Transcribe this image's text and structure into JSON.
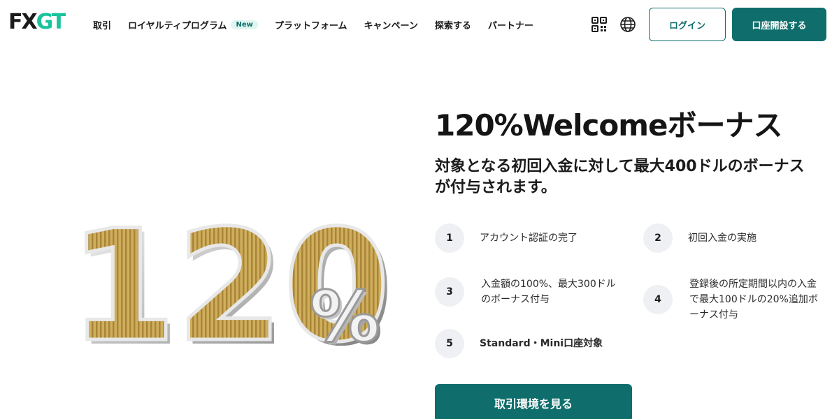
{
  "header": {
    "logo": {
      "part1": "FX",
      "part2": "GT"
    },
    "nav": [
      {
        "label": "取引"
      },
      {
        "label": "ロイヤルティプログラム",
        "badge": "New"
      },
      {
        "label": "プラットフォーム"
      },
      {
        "label": "キャンペーン"
      },
      {
        "label": "探索する"
      },
      {
        "label": "パートナー"
      }
    ],
    "icons": {
      "qr": "qr-code-icon",
      "language": "globe-icon"
    },
    "login_label": "ログイン",
    "open_account_label": "口座開設する"
  },
  "hero": {
    "graphic": {
      "number": "120",
      "symbol": "%"
    },
    "title": "120%Welcomeボーナス",
    "subtitle": "対象となる初回入金に対して最大400ドルのボーナスが付与されます。",
    "steps": [
      {
        "num": "1",
        "text": "アカウント認証の完了"
      },
      {
        "num": "2",
        "text": "初回入金の実施"
      },
      {
        "num": "3",
        "text": "入金額の100%、最大300ドルのボーナス付与"
      },
      {
        "num": "4",
        "text": "登録後の所定期間以内の入金で最大100ドルの20%追加ボーナス付与"
      },
      {
        "num": "5",
        "text": "Standard・Mini口座対象"
      }
    ],
    "cta_label": "取引環境を見る"
  },
  "colors": {
    "brand": "#0f6e6b",
    "logo_accent": "#19c39c",
    "badge_bg": "#dff5ef",
    "step_circle": "#eef0f3",
    "gold": "#c9a64a"
  }
}
